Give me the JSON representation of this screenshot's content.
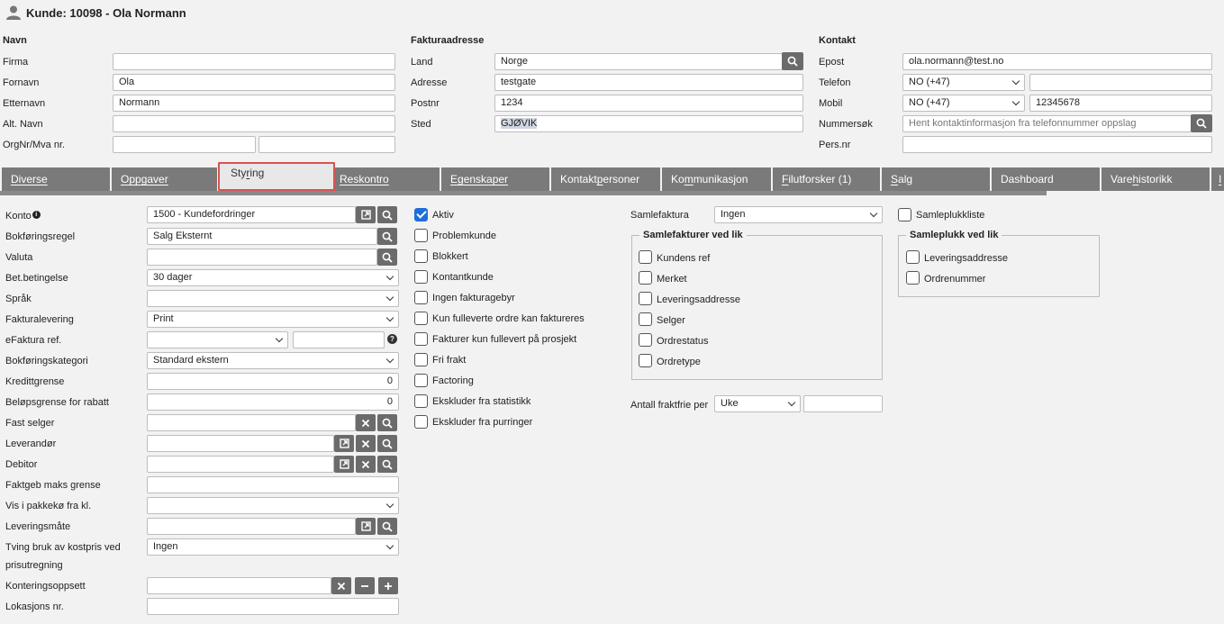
{
  "header": {
    "title": "Kunde: 10098 - Ola Normann"
  },
  "navn": {
    "heading": "Navn",
    "firma_label": "Firma",
    "firma": "",
    "fornavn_label": "Fornavn",
    "fornavn": "Ola",
    "etternavn_label": "Etternavn",
    "etternavn": "Normann",
    "alt_navn_label": "Alt. Navn",
    "alt_navn": "",
    "orgnr_label": "OrgNr/Mva nr.",
    "orgnr": "",
    "mva": ""
  },
  "faktura": {
    "heading": "Fakturaadresse",
    "land_label": "Land",
    "land": "Norge",
    "adresse_label": "Adresse",
    "adresse": "testgate",
    "postnr_label": "Postnr",
    "postnr": "1234",
    "sted_label": "Sted",
    "sted": "GJØVIK"
  },
  "kontakt": {
    "heading": "Kontakt",
    "epost_label": "Epost",
    "epost": "ola.normann@test.no",
    "telefon_label": "Telefon",
    "telefon_cc": "NO (+47)",
    "telefon": "",
    "mobil_label": "Mobil",
    "mobil_cc": "NO (+47)",
    "mobil": "12345678",
    "nummersok_label": "Nummersøk",
    "nummersok_placeholder": "Hent kontaktinformasjon fra telefonnummer oppslag",
    "persnr_label": "Pers.nr",
    "persnr": ""
  },
  "tabs": [
    {
      "pre": "",
      "u": "D",
      "post": "iverse"
    },
    {
      "pre": "",
      "u": "O",
      "post": "ppgaver"
    },
    {
      "pre": "Sty",
      "u": "r",
      "post": "ing"
    },
    {
      "pre": "",
      "u": "R",
      "post": "eskontro"
    },
    {
      "pre": "",
      "u": "E",
      "post": "genskaper"
    },
    {
      "pre": "Kontakt",
      "u": "p",
      "post": "ersoner"
    },
    {
      "pre": "Ko",
      "u": "m",
      "post": "munikasjon"
    },
    {
      "pre": "",
      "u": "F",
      "post": "ilutforsker (1)"
    },
    {
      "pre": "",
      "u": "S",
      "post": "alg"
    },
    {
      "pre": "Dashboard",
      "u": "",
      "post": ""
    },
    {
      "pre": "Vare",
      "u": "h",
      "post": "istorikk"
    },
    {
      "pre": "",
      "u": "I",
      "post": ""
    }
  ],
  "styring": {
    "konto_label": "Konto",
    "konto": "1500 - Kundefordringer",
    "bokforingsregel_label": "Bokføringsregel",
    "bokforingsregel": "Salg Eksternt",
    "valuta_label": "Valuta",
    "valuta": "",
    "betingelse_label": "Bet.betingelse",
    "betingelse": "30 dager",
    "sprak_label": "Språk",
    "sprak": "",
    "fakturalevering_label": "Fakturalevering",
    "fakturalevering": "Print",
    "efaktura_label": "eFaktura ref.",
    "efaktura": "",
    "efaktura_text": "",
    "bokforingskategori_label": "Bokføringskategori",
    "bokforingskategori": "Standard ekstern",
    "kredittgrense_label": "Kredittgrense",
    "kredittgrense": "0",
    "belopsgrense_label": "Beløpsgrense for rabatt",
    "belopsgrense": "0",
    "fast_selger_label": "Fast selger",
    "fast_selger": "",
    "leverandor_label": "Leverandør",
    "leverandor": "",
    "debitor_label": "Debitor",
    "debitor": "",
    "faktgeb_label": "Faktgeb maks grense",
    "faktgeb": "",
    "vis_pakkeko_label": "Vis i pakkekø fra kl.",
    "vis_pakkeko": "",
    "leveringsmate_label": "Leveringsmåte",
    "leveringsmate": "",
    "tving_label_1": "Tving bruk av kostpris ved",
    "tving_label_2": "prisutregning",
    "tving": "Ingen",
    "kontering_label": "Konteringsoppsett",
    "kontering": "",
    "lokasjon_label": "Lokasjons nr.",
    "lokasjon": ""
  },
  "checks": [
    {
      "label": "Aktiv",
      "checked": true
    },
    {
      "label": "Problemkunde",
      "checked": false
    },
    {
      "label": "Blokkert",
      "checked": false
    },
    {
      "label": "Kontantkunde",
      "checked": false
    },
    {
      "label": "Ingen fakturagebyr",
      "checked": false
    },
    {
      "label": "Kun fulleverte ordre kan faktureres",
      "checked": false
    },
    {
      "label": "Fakturer kun fullevert på prosjekt",
      "checked": false
    },
    {
      "label": "Fri frakt",
      "checked": false
    },
    {
      "label": "Factoring",
      "checked": false
    },
    {
      "label": "Ekskluder fra statistikk",
      "checked": false
    },
    {
      "label": "Ekskluder fra purringer",
      "checked": false
    }
  ],
  "samlefaktura": {
    "label": "Samlefaktura",
    "value": "Ingen",
    "legend": "Samlefakturer ved lik",
    "items": [
      "Kundens ref",
      "Merket",
      "Leveringsaddresse",
      "Selger",
      "Ordrestatus",
      "Ordretype"
    ],
    "antall_label": "Antall fraktfrie per",
    "antall_select": "Uke",
    "antall_value": ""
  },
  "samleplukk": {
    "checkbox_label": "Samleplukkliste",
    "legend": "Samleplukk ved lik",
    "items": [
      "Leveringsaddresse",
      "Ordrenummer"
    ]
  },
  "colors": {
    "tab_bg": "#7a7a7a",
    "active_outline": "#d9534f",
    "button_bg": "#6b6b6b",
    "check_blue": "#1e6fd9"
  }
}
